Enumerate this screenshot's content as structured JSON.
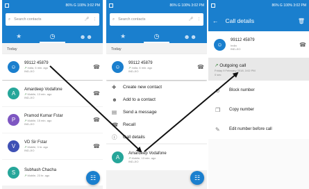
{
  "status": {
    "text": "86% G 100% 3:02 PM"
  },
  "search": {
    "placeholder": "Search contacts"
  },
  "section": {
    "today": "Today"
  },
  "call_log": [
    {
      "name": "99112 45879",
      "detail": "India, 6 min. ago",
      "carrier": "IND-JIO",
      "initial": "",
      "color": "#1a7fce"
    },
    {
      "name": "Amardeep Vodafone",
      "detail": "Mobile, 13 min. ago",
      "carrier": "IND-JIO",
      "initial": "A",
      "color": "#26a69a"
    },
    {
      "name": "Pramod Kumar Fstar",
      "detail": "Mobile, 15 min. ago",
      "carrier": "IND-JIO",
      "initial": "P",
      "color": "#7e57c2"
    },
    {
      "name": "VD Sir Fstar",
      "detail": "Mobile, 3 hr. ago",
      "carrier": "IND-JIO",
      "initial": "V",
      "color": "#3f51b5"
    },
    {
      "name": "Subhash Chacha",
      "detail": "Mobile, 23 hr. ago",
      "carrier": "",
      "initial": "S",
      "color": "#26a69a"
    }
  ],
  "menu": {
    "items": [
      {
        "label": "Create new contact",
        "icon": "person-add-icon"
      },
      {
        "label": "Add to a contact",
        "icon": "person-icon"
      },
      {
        "label": "Send a message",
        "icon": "message-icon"
      },
      {
        "label": "Recall",
        "icon": "phone-icon"
      },
      {
        "label": "Call details",
        "icon": "info-icon"
      }
    ]
  },
  "details": {
    "title": "Call details",
    "number": "99112 45879",
    "region": "India",
    "carrier": "IND-JIO",
    "call_type": "Outgoing call",
    "call_date": "Friday 9 February 2018, 3:02 PM",
    "call_duration": "0 sec",
    "actions": [
      {
        "label": "Block number",
        "icon": "block-icon"
      },
      {
        "label": "Copy number",
        "icon": "copy-icon"
      },
      {
        "label": "Edit number before call",
        "icon": "edit-icon"
      }
    ]
  },
  "colors": {
    "primary": "#1a7fce",
    "outgoing_arrow": "#2e7d32"
  }
}
